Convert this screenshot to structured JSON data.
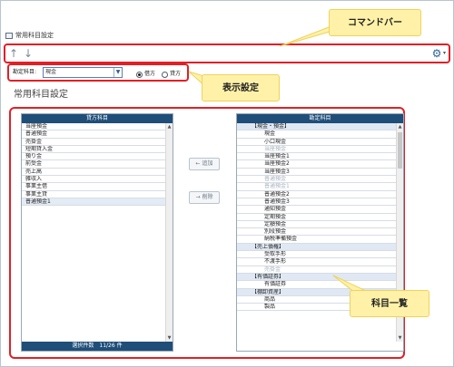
{
  "window": {
    "tab_label": "常用科目設定"
  },
  "commandbar": {
    "up_icon": "arrow-up",
    "down_icon": "arrow-down",
    "settings_icon": "gear",
    "callout": "コマンドバー"
  },
  "settings": {
    "label": "勘定科目:",
    "select_value": "現金",
    "radio_debit": "借方",
    "radio_credit": "貸方",
    "selected": "debit",
    "callout": "表示設定"
  },
  "page_title": "常用科目設定",
  "left_panel": {
    "header": "貸方科目",
    "items": [
      "当座預金",
      "普通預金",
      "売掛金",
      "短期貸入金",
      "預り金",
      "前受金",
      "売上高",
      "雑収入",
      "事業主借",
      "事業主貸",
      "普通預金1"
    ],
    "selected_index": 10,
    "footer": "選択件数　11/26 件"
  },
  "buttons": {
    "add": "← 追加",
    "remove": "→ 削除"
  },
  "right_panel": {
    "header": "勘定科目",
    "items": [
      {
        "text": "【現金・預金】",
        "type": "cat"
      },
      {
        "text": "現金",
        "type": "sub"
      },
      {
        "text": "小口現金",
        "type": "sub"
      },
      {
        "text": "当座預金",
        "type": "sub",
        "dim": true
      },
      {
        "text": "当座預金1",
        "type": "sub"
      },
      {
        "text": "当座預金2",
        "type": "sub"
      },
      {
        "text": "当座預金3",
        "type": "sub"
      },
      {
        "text": "普通預金",
        "type": "sub",
        "dim": true
      },
      {
        "text": "普通預金1",
        "type": "sub",
        "dim": true
      },
      {
        "text": "普通預金2",
        "type": "sub"
      },
      {
        "text": "普通預金3",
        "type": "sub"
      },
      {
        "text": "通知預金",
        "type": "sub"
      },
      {
        "text": "定期預金",
        "type": "sub"
      },
      {
        "text": "定額預金",
        "type": "sub"
      },
      {
        "text": "別段預金",
        "type": "sub"
      },
      {
        "text": "納税準備預金",
        "type": "sub"
      },
      {
        "text": "【売上債権】",
        "type": "cat"
      },
      {
        "text": "受取手形",
        "type": "sub"
      },
      {
        "text": "不渡手形",
        "type": "sub"
      },
      {
        "text": "売掛金",
        "type": "sub",
        "dim": true
      },
      {
        "text": "【有価証券】",
        "type": "cat"
      },
      {
        "text": "有価証券",
        "type": "sub"
      },
      {
        "text": "【棚卸資産】",
        "type": "cat"
      },
      {
        "text": "商品",
        "type": "sub"
      },
      {
        "text": "製品",
        "type": "sub"
      }
    ]
  },
  "list_callout": "科目一覧",
  "colors": {
    "highlight": "#e21f26",
    "header": "#1f4e79",
    "callout": "#fff2a8"
  }
}
